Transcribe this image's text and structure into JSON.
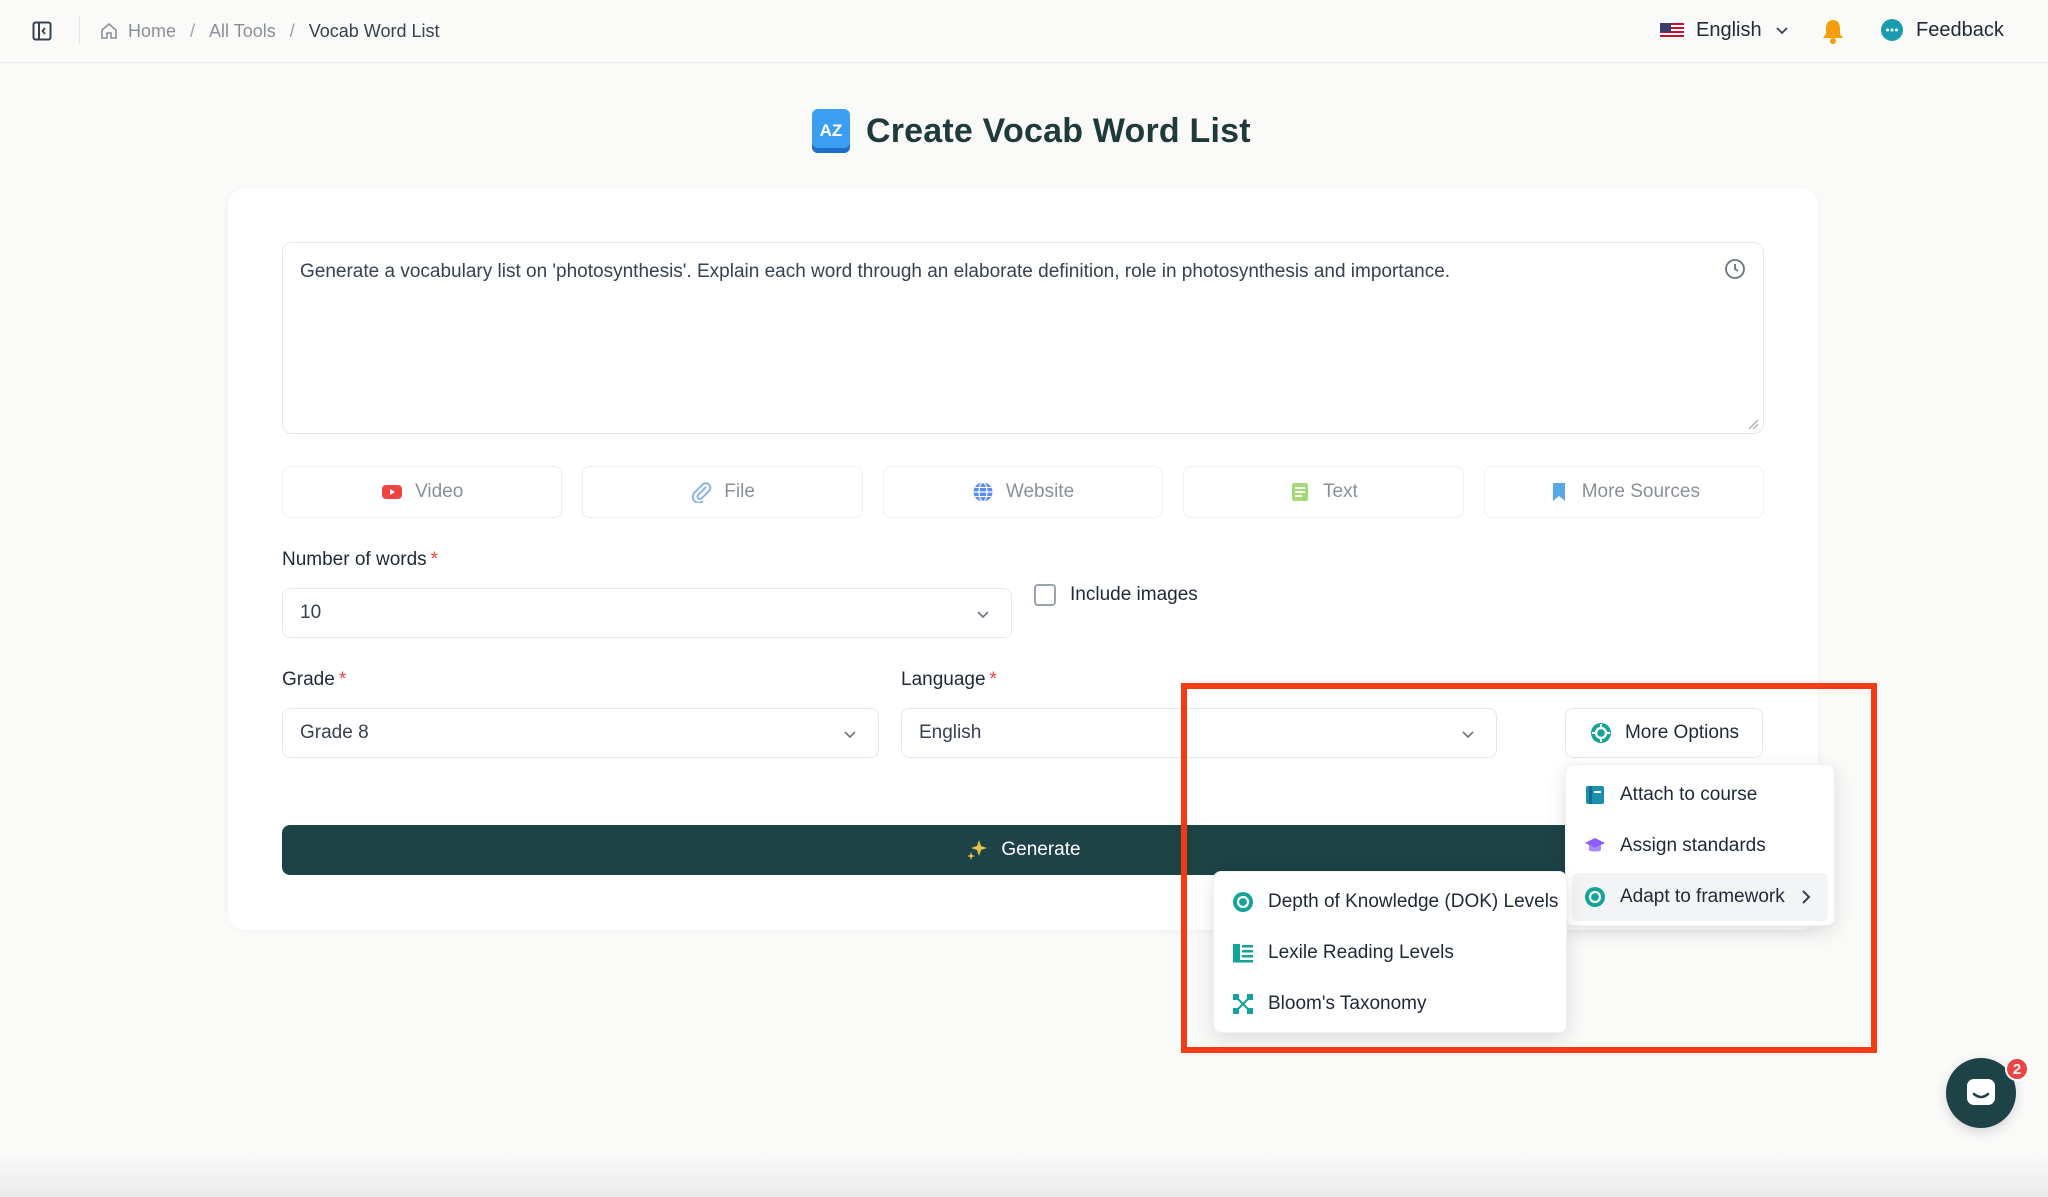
{
  "header": {
    "breadcrumb": [
      "Home",
      "All Tools",
      "Vocab Word List"
    ],
    "language": "English",
    "feedback_label": "Feedback"
  },
  "page": {
    "title": "Create Vocab Word List",
    "icon_text": "AZ"
  },
  "form": {
    "prompt": "Generate a vocabulary list on 'photosynthesis'. Explain each word through an elaborate definition, role in photosynthesis and importance.",
    "sources": [
      {
        "label": "Video",
        "icon": "video-icon"
      },
      {
        "label": "File",
        "icon": "paperclip-icon"
      },
      {
        "label": "Website",
        "icon": "globe-icon"
      },
      {
        "label": "Text",
        "icon": "text-doc-icon"
      },
      {
        "label": "More Sources",
        "icon": "bookmark-icon"
      }
    ],
    "number_of_words": {
      "label": "Number of words",
      "value": "10"
    },
    "include_images_label": "Include images",
    "grade": {
      "label": "Grade",
      "value": "Grade 8"
    },
    "language": {
      "label": "Language",
      "value": "English"
    },
    "more_options_label": "More Options",
    "generate_label": "Generate"
  },
  "more_options_menu": [
    {
      "label": "Attach to course",
      "icon": "course-book-icon"
    },
    {
      "label": "Assign standards",
      "icon": "graduation-cap-icon"
    },
    {
      "label": "Adapt to framework",
      "icon": "framework-icon",
      "active": true
    }
  ],
  "framework_submenu": [
    {
      "label": "Depth of Knowledge (DOK) Levels",
      "icon": "dok-icon"
    },
    {
      "label": "Lexile Reading Levels",
      "icon": "lexile-icon"
    },
    {
      "label": "Bloom's Taxonomy",
      "icon": "blooms-icon"
    }
  ],
  "chat": {
    "badge_count": "2"
  },
  "colors": {
    "brand_dark": "#1d4347",
    "highlight": "#f33b16",
    "required": "#ef4444"
  }
}
